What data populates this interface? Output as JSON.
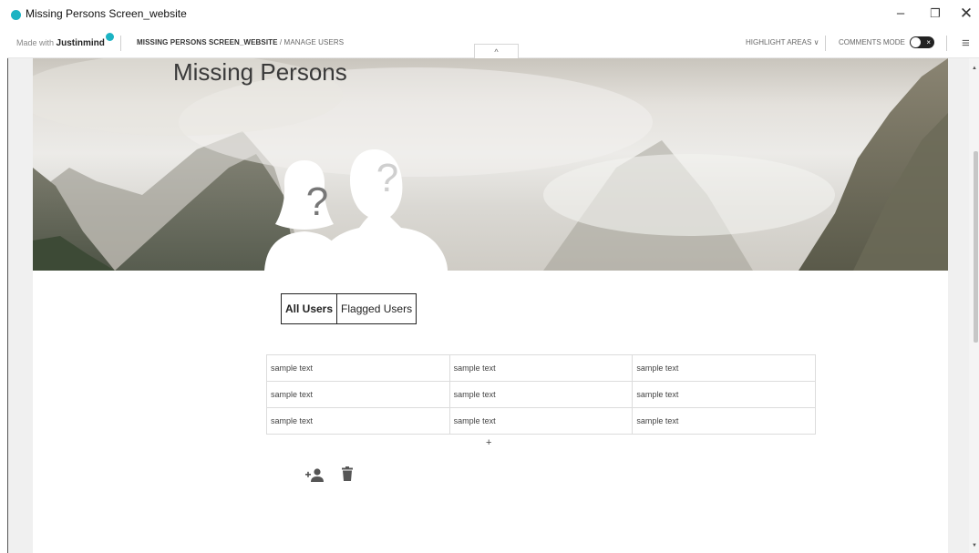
{
  "window": {
    "title": "Missing Persons Screen_website",
    "minimize": "–",
    "maximize": "❐",
    "close": "✕"
  },
  "toolbar": {
    "made_with": "Made with",
    "brand": "Justinmind",
    "project": "MISSING PERSONS SCREEN_WEBSITE",
    "page": " / MANAGE USERS",
    "collapse_icon": "^",
    "highlight_label": "HIGHLIGHT AREAS",
    "highlight_chevron": "∨",
    "comments_label": "COMMENTS MODE",
    "comments_toggle_off": "×",
    "menu_icon": "≡"
  },
  "page": {
    "title": "Missing Persons",
    "tabs": [
      {
        "label": "All Users",
        "active": true
      },
      {
        "label": "Flagged Users",
        "active": false
      }
    ],
    "table": {
      "rows": [
        [
          "sample text",
          "sample text",
          "sample text"
        ],
        [
          "sample text",
          "sample text",
          "sample text"
        ],
        [
          "sample text",
          "sample text",
          "sample text"
        ]
      ]
    },
    "add_row": "+",
    "placeholder_glyph": "?"
  },
  "colors": {
    "accent": "#1bb3c3",
    "toggle_bg": "#222222",
    "table_border": "#dcdcdc"
  },
  "icons": {
    "add_user": "add-user-icon",
    "delete": "trash-icon"
  }
}
